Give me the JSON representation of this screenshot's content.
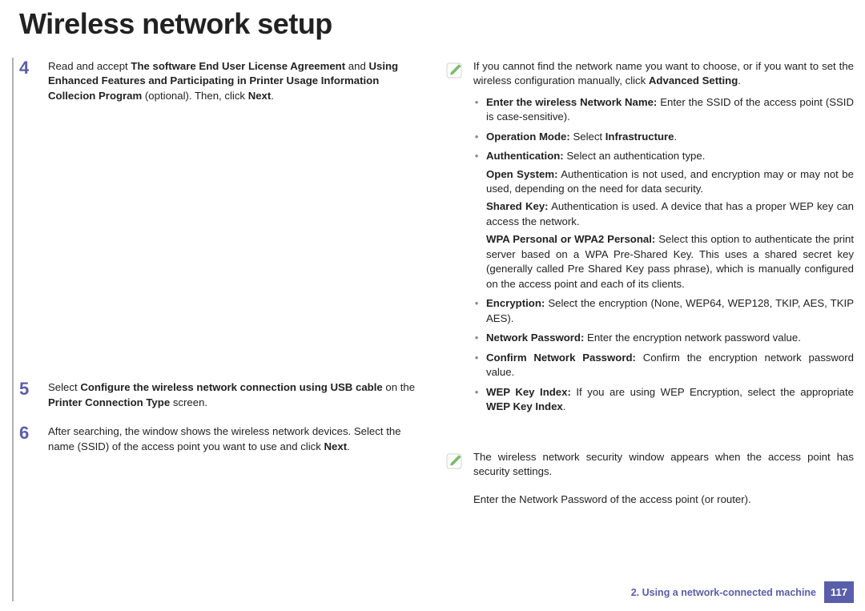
{
  "title": "Wireless network setup",
  "steps": {
    "s4": {
      "num": "4",
      "parts": [
        {
          "t": "Read and accept "
        },
        {
          "t": "The software End User License Agreement ",
          "b": true
        },
        {
          "t": " and "
        },
        {
          "t": "Using Enhanced Features and Participating in Printer Usage Information Collecion Program",
          "b": true
        },
        {
          "t": " (optional). Then, click "
        },
        {
          "t": "Next",
          "b": true
        },
        {
          "t": "."
        }
      ]
    },
    "s5": {
      "num": "5",
      "parts": [
        {
          "t": "Select "
        },
        {
          "t": "Configure the wireless network connection using USB cable",
          "b": true
        },
        {
          "t": " on the "
        },
        {
          "t": "Printer Connection Type",
          "b": true
        },
        {
          "t": " screen."
        }
      ]
    },
    "s6": {
      "num": "6",
      "parts": [
        {
          "t": "After searching, the window shows the wireless network devices. Select the name (SSID) of the access point you want to use and click "
        },
        {
          "t": "Next",
          "b": true
        },
        {
          "t": "."
        }
      ]
    }
  },
  "note1": {
    "intro_parts": [
      {
        "t": "If you cannot find the network name you want to choose, or if you want to set the wireless configuration manually, click "
      },
      {
        "t": "Advanced Setting",
        "b": true
      },
      {
        "t": "."
      }
    ],
    "bullets": [
      {
        "parts": [
          {
            "t": "Enter the wireless Network Name:",
            "b": true
          },
          {
            "t": " Enter the SSID of the access point (SSID is case-sensitive)."
          }
        ]
      },
      {
        "parts": [
          {
            "t": "Operation Mode:",
            "b": true
          },
          {
            "t": " Select "
          },
          {
            "t": "Infrastructure",
            "b": true
          },
          {
            "t": "."
          }
        ]
      },
      {
        "parts": [
          {
            "t": "Authentication:",
            "b": true
          },
          {
            "t": " Select an authentication type."
          }
        ],
        "subs": [
          {
            "parts": [
              {
                "t": "Open System:",
                "b": true
              },
              {
                "t": " Authentication is not used, and encryption may or may not be used, depending on the need for data security."
              }
            ]
          },
          {
            "parts": [
              {
                "t": "Shared Key:",
                "b": true
              },
              {
                "t": " Authentication is used. A device that has a proper WEP key can access the network."
              }
            ]
          },
          {
            "parts": [
              {
                "t": "WPA Personal or WPA2 Personal:",
                "b": true
              },
              {
                "t": " Select this option to authenticate the print server based on a WPA Pre-Shared Key. This uses a shared secret key (generally called Pre Shared Key pass phrase), which is manually configured on the access point and each of its clients."
              }
            ]
          }
        ]
      },
      {
        "parts": [
          {
            "t": "Encryption:",
            "b": true
          },
          {
            "t": " Select the encryption (None, WEP64, WEP128, TKIP, AES, TKIP AES)."
          }
        ]
      },
      {
        "parts": [
          {
            "t": "Network Password:",
            "b": true
          },
          {
            "t": " Enter the encryption network password value."
          }
        ]
      },
      {
        "parts": [
          {
            "t": "Confirm Network Password:",
            "b": true
          },
          {
            "t": " Confirm the encryption network password value."
          }
        ]
      },
      {
        "parts": [
          {
            "t": "WEP Key Index:",
            "b": true
          },
          {
            "t": " If you are using WEP Encryption, select the appropriate "
          },
          {
            "t": "WEP Key Index",
            "b": true
          },
          {
            "t": "."
          }
        ]
      }
    ]
  },
  "note2": {
    "intro_parts": [
      {
        "t": "The wireless network security window appears when the access point has security settings."
      }
    ],
    "followup_parts": [
      {
        "t": "Enter the Network Password of the access point (or router)."
      }
    ]
  },
  "footer": {
    "chapter": "2.  Using a network-connected machine",
    "page": "117"
  }
}
